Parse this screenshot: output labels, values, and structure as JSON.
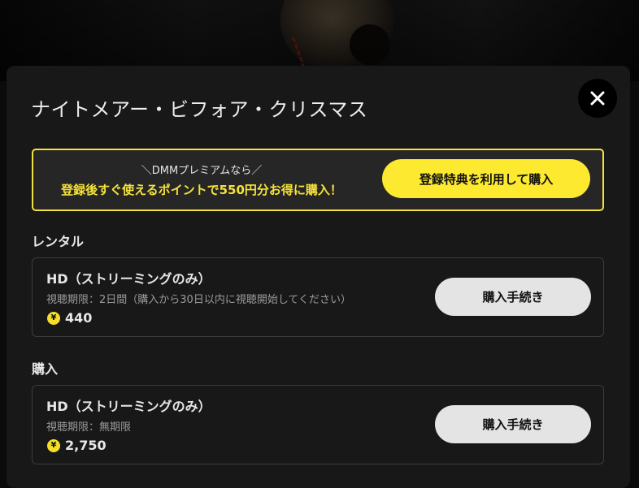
{
  "modal": {
    "title": "ナイトメアー・ビフォア・クリスマス",
    "close_icon": "close-icon"
  },
  "promo": {
    "line1": "＼DMMプレミアムなら／",
    "line2": "登録後すぐ使えるポイントで550円分お得に購入！",
    "button_label": "登録特典を利用して購入",
    "accent_color": "#fde92f"
  },
  "sections": [
    {
      "heading": "レンタル",
      "option": {
        "name": "HD（ストリーミングのみ）",
        "period": "視聴期限：2日間（購入から30日以内に視聴開始してください）",
        "coin_symbol": "¥",
        "price": "440",
        "button_label": "購入手続き"
      }
    },
    {
      "heading": "購入",
      "option": {
        "name": "HD（ストリーミングのみ）",
        "period": "視聴期限：無期限",
        "coin_symbol": "¥",
        "price": "2,750",
        "button_label": "購入手続き"
      }
    }
  ]
}
